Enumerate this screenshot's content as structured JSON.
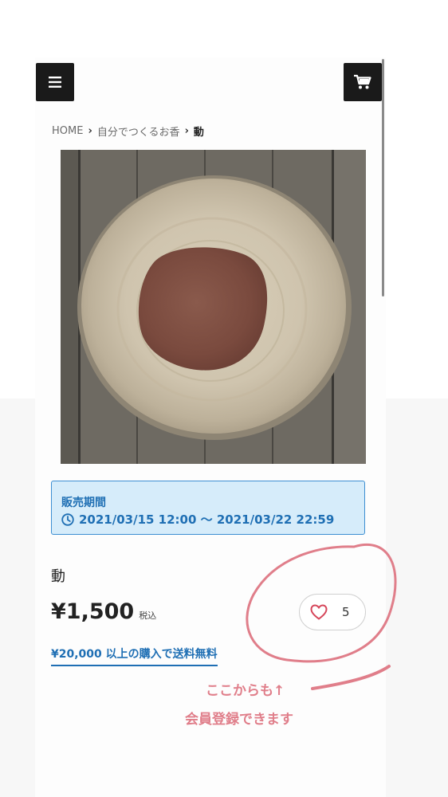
{
  "header": {
    "menu_icon": "hamburger-menu-icon",
    "cart_icon": "shopping-cart-icon"
  },
  "breadcrumb": {
    "items": [
      "HOME",
      "自分でつくるお香",
      "動"
    ]
  },
  "sale_period": {
    "title": "販売期間",
    "dates": "2021/03/15 12:00 〜 2021/03/22 22:59",
    "icon": "clock-icon"
  },
  "product": {
    "name": "動",
    "price": "¥1,500",
    "tax_label": "税込",
    "like_count": "5",
    "shipping_note": "¥20,000 以上の購入で送料無料"
  },
  "annotation": {
    "line1": "ここからも↑",
    "line2": "会員登録できます",
    "color": "#e07e8a"
  },
  "colors": {
    "accent_blue": "#1f6fb4",
    "sale_bg": "#d6ecfa",
    "button_dark": "#1a1a1a"
  }
}
